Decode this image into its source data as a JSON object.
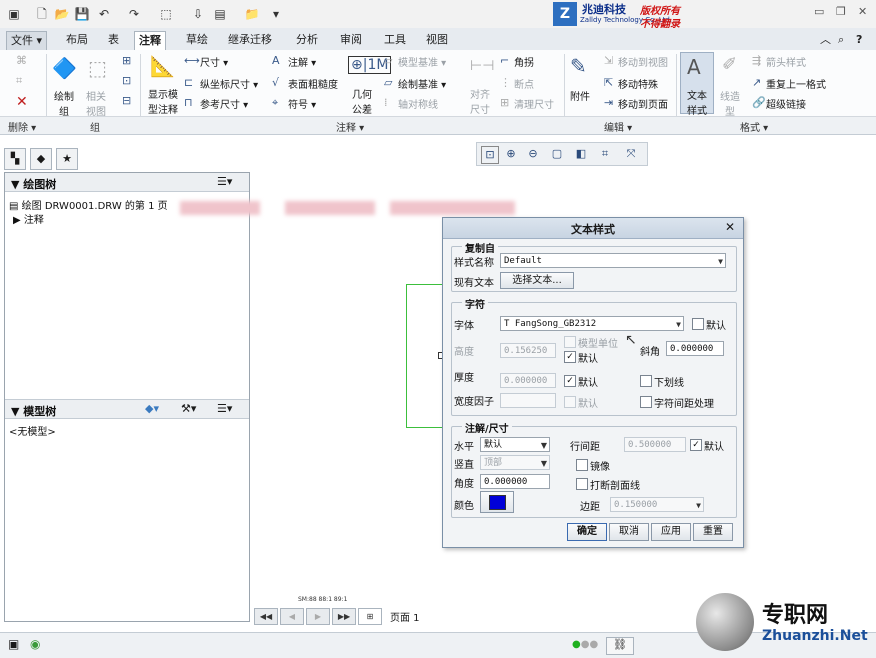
{
  "branding": {
    "company": "兆迪科技",
    "company_en": "Zalldy Technology Co.,Ltd.",
    "notice1": "版权所有",
    "notice2": "不得翻录",
    "logo_text": "Z"
  },
  "tabs": [
    "文件",
    "布局",
    "表",
    "注释",
    "草绘",
    "继承迁移",
    "分析",
    "审阅",
    "工具",
    "视图"
  ],
  "active_tab": "注释",
  "ribbon": {
    "delete_group": "删除",
    "group_group": "组",
    "annot_group": "注释",
    "edit_group": "编辑",
    "format_group": "格式",
    "draw_group": "绘制组",
    "related_view": "相关视图",
    "show_model_annot": "显示模型注释",
    "dimension": "尺寸",
    "ordinate_dim": "纵坐标尺寸",
    "ref_dim": "参考尺寸",
    "note": "注解",
    "surface_finish": "表面粗糙度",
    "symbol": "符号",
    "geo_tol": "几何公差",
    "model_datum": "模型基准",
    "draw_datum": "绘制基准",
    "axis_sym": "轴对称线",
    "align_dim": "对齐尺寸",
    "corner": "角拐",
    "break": "断点",
    "clean_dim": "清理尺寸",
    "attach": "附件",
    "move_to_view": "移动到视图",
    "move_special": "移动特殊",
    "move_to_page": "移动到页面",
    "text_style": "文本样式",
    "line_style": "线造型",
    "arrow_style": "箭头样式",
    "repeat_last": "重复上一格式",
    "hyperlink": "超级链接"
  },
  "tree": {
    "title": "绘图树",
    "root": "绘图 DRW0001.DRW 的第 1 页",
    "child": "注释"
  },
  "model_tree": {
    "title": "模型树",
    "item": "<无模型>"
  },
  "pagebar": {
    "label": "页面 1"
  },
  "canvas": {
    "coords": "SM:88  88:1  89:1"
  },
  "dialog": {
    "title": "文本样式",
    "copy_from": "复制自",
    "style_name_label": "样式名称",
    "style_name": "Default",
    "existing_text_label": "现有文本",
    "select_text_btn": "选择文本...",
    "char_section": "字符",
    "font_label": "字体",
    "font_value": "FangSong_GB2312",
    "default": "默认",
    "height_label": "高度",
    "height_value": "0.156250",
    "model_units": "模型单位",
    "slant_label": "斜角",
    "slant_value": "0.000000",
    "thickness_label": "厚度",
    "thickness_value": "0.000000",
    "underline": "下划线",
    "width_factor_label": "宽度因子",
    "kerning": "字符间距处理",
    "note_section": "注解/尺寸",
    "horizontal_label": "水平",
    "horizontal_value": "默认",
    "vertical_label": "竖直",
    "vertical_value": "顶部",
    "angle_label": "角度",
    "angle_value": "0.000000",
    "color_label": "颜色",
    "color_hex": "#0000d8",
    "line_spacing_label": "行间距",
    "line_spacing_value": "0.500000",
    "mirror": "镜像",
    "break_xhatch": "打断剖面线",
    "margin_label": "边距",
    "margin_value": "0.150000",
    "ok": "确定",
    "cancel": "取消",
    "apply": "应用",
    "reset": "重置"
  },
  "watermark": {
    "cn": "专职网",
    "en": "Zhuanzhi.Net"
  }
}
